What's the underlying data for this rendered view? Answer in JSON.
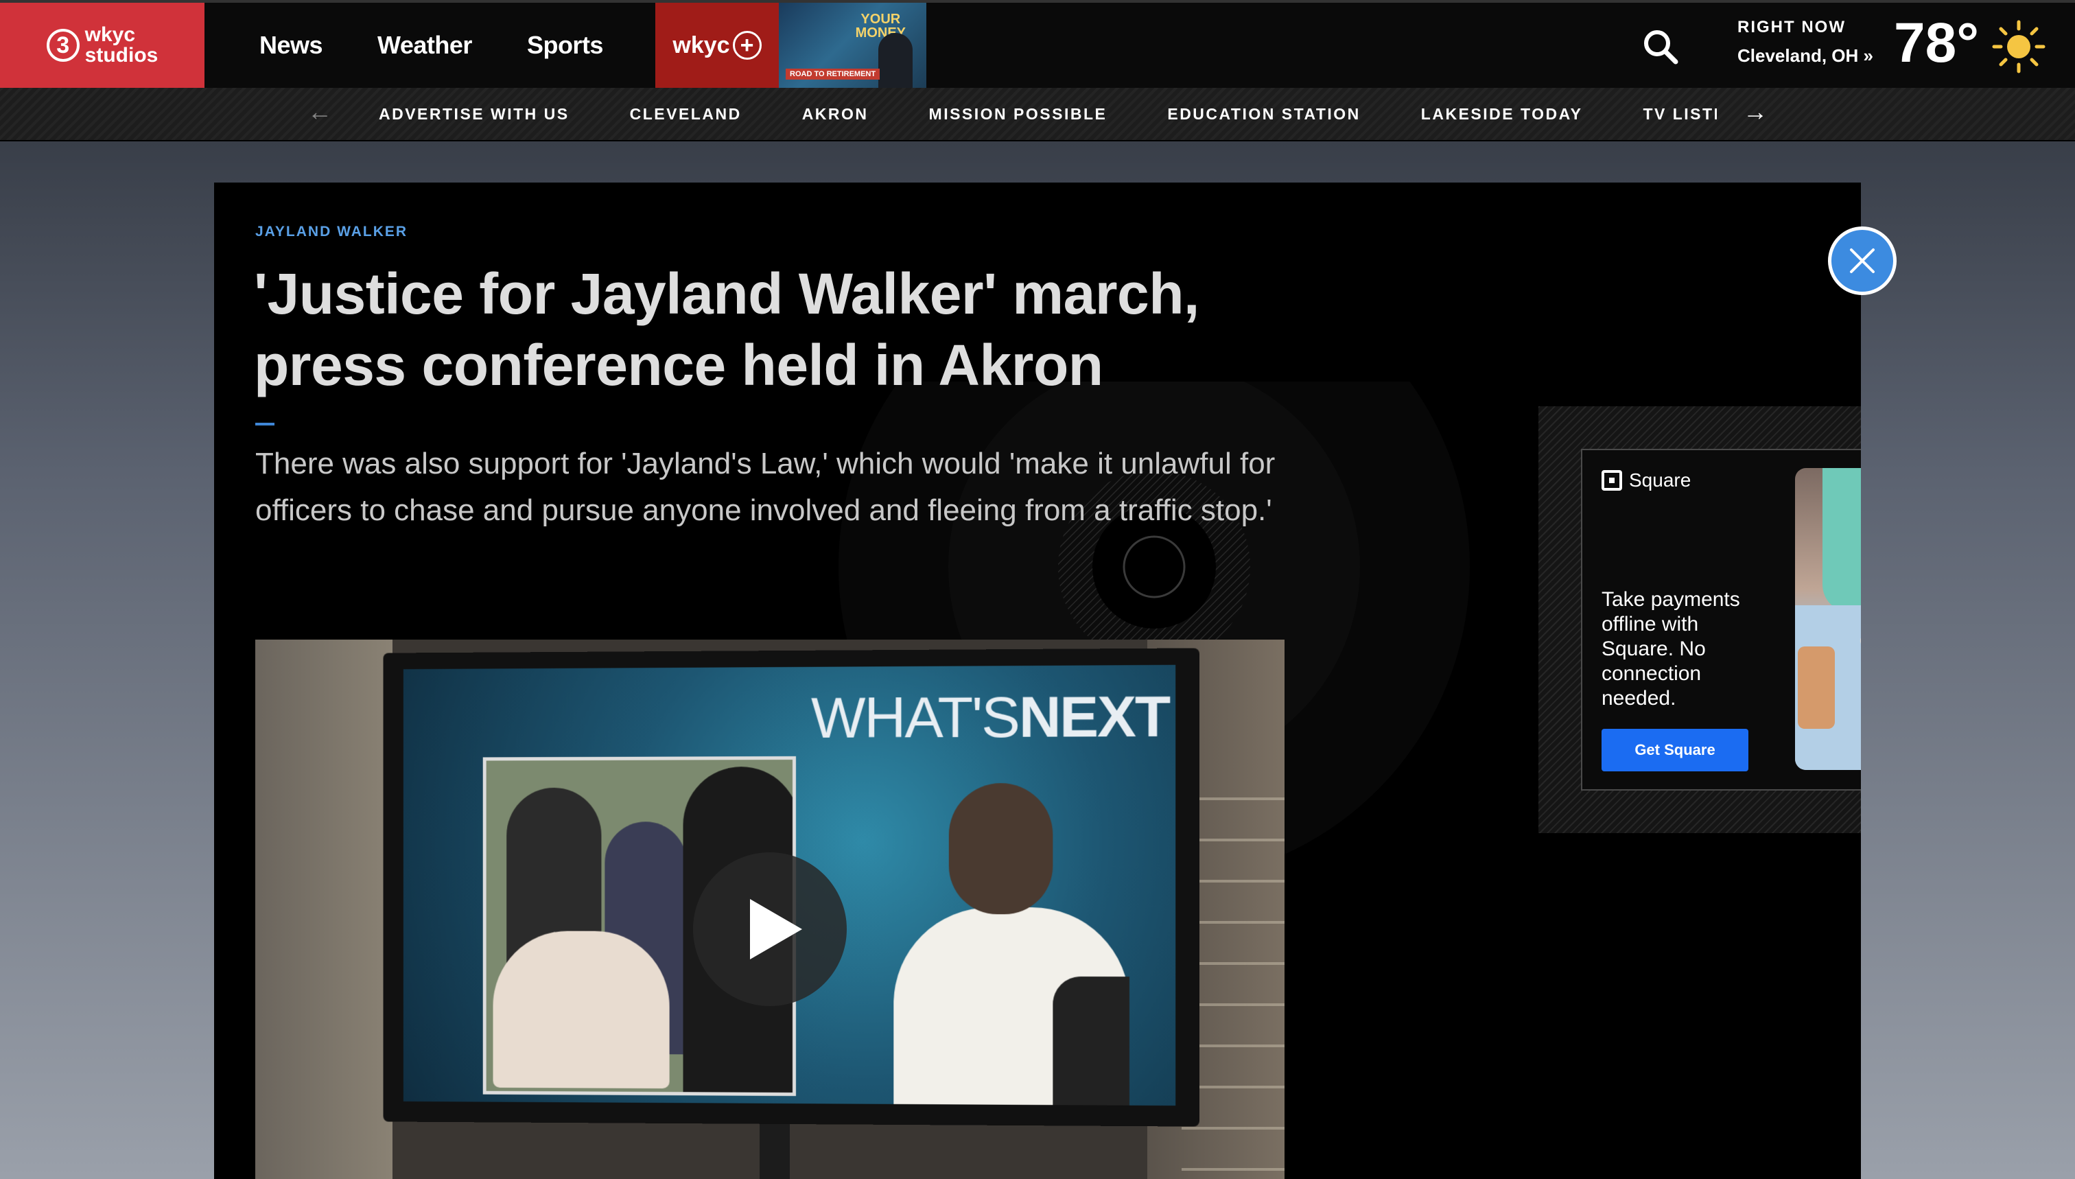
{
  "header": {
    "logo": {
      "number": "3",
      "line1": "wkyc",
      "line2": "studios"
    },
    "nav": [
      "News",
      "Weather",
      "Sports"
    ],
    "plus_label": "wkyc",
    "promo": {
      "title_line1": "YOUR",
      "title_line2": "MONEY",
      "sub": "ROAD TO RETIREMENT"
    },
    "weather": {
      "right_now": "RIGHT NOW",
      "location": "Cleveland, OH »",
      "temp": "78°",
      "condition_icon": "sun-icon"
    }
  },
  "subnav": {
    "items": [
      "ADVERTISE WITH US",
      "CLEVELAND",
      "AKRON",
      "MISSION POSSIBLE",
      "EDUCATION STATION",
      "LAKESIDE TODAY",
      "TV LISTINGS"
    ],
    "prev_icon": "arrow-left-icon",
    "next_icon": "arrow-right-icon"
  },
  "article": {
    "kicker": "JAYLAND WALKER",
    "headline": "'Justice for Jayland Walker' march, press conference held in Akron",
    "dek": "There was also support for 'Jayland's Law,' which would 'make it unlawful for officers to chase and pursue anyone involved and fleeing from a traffic stop.'",
    "video": {
      "screen_text_light": "WHAT'S",
      "screen_text_bold": "NEXT",
      "play_icon": "play-icon"
    }
  },
  "ad": {
    "brand": "Square",
    "copy": "Take payments offline with Square. No connection needed.",
    "cta": "Get Square"
  },
  "close_icon": "close-icon",
  "colors": {
    "brand_red": "#d0323a",
    "plus_red": "#a01c18",
    "kicker_blue": "#5aa0e6",
    "cta_blue": "#1b6cf2",
    "close_blue": "#3c8be0"
  }
}
